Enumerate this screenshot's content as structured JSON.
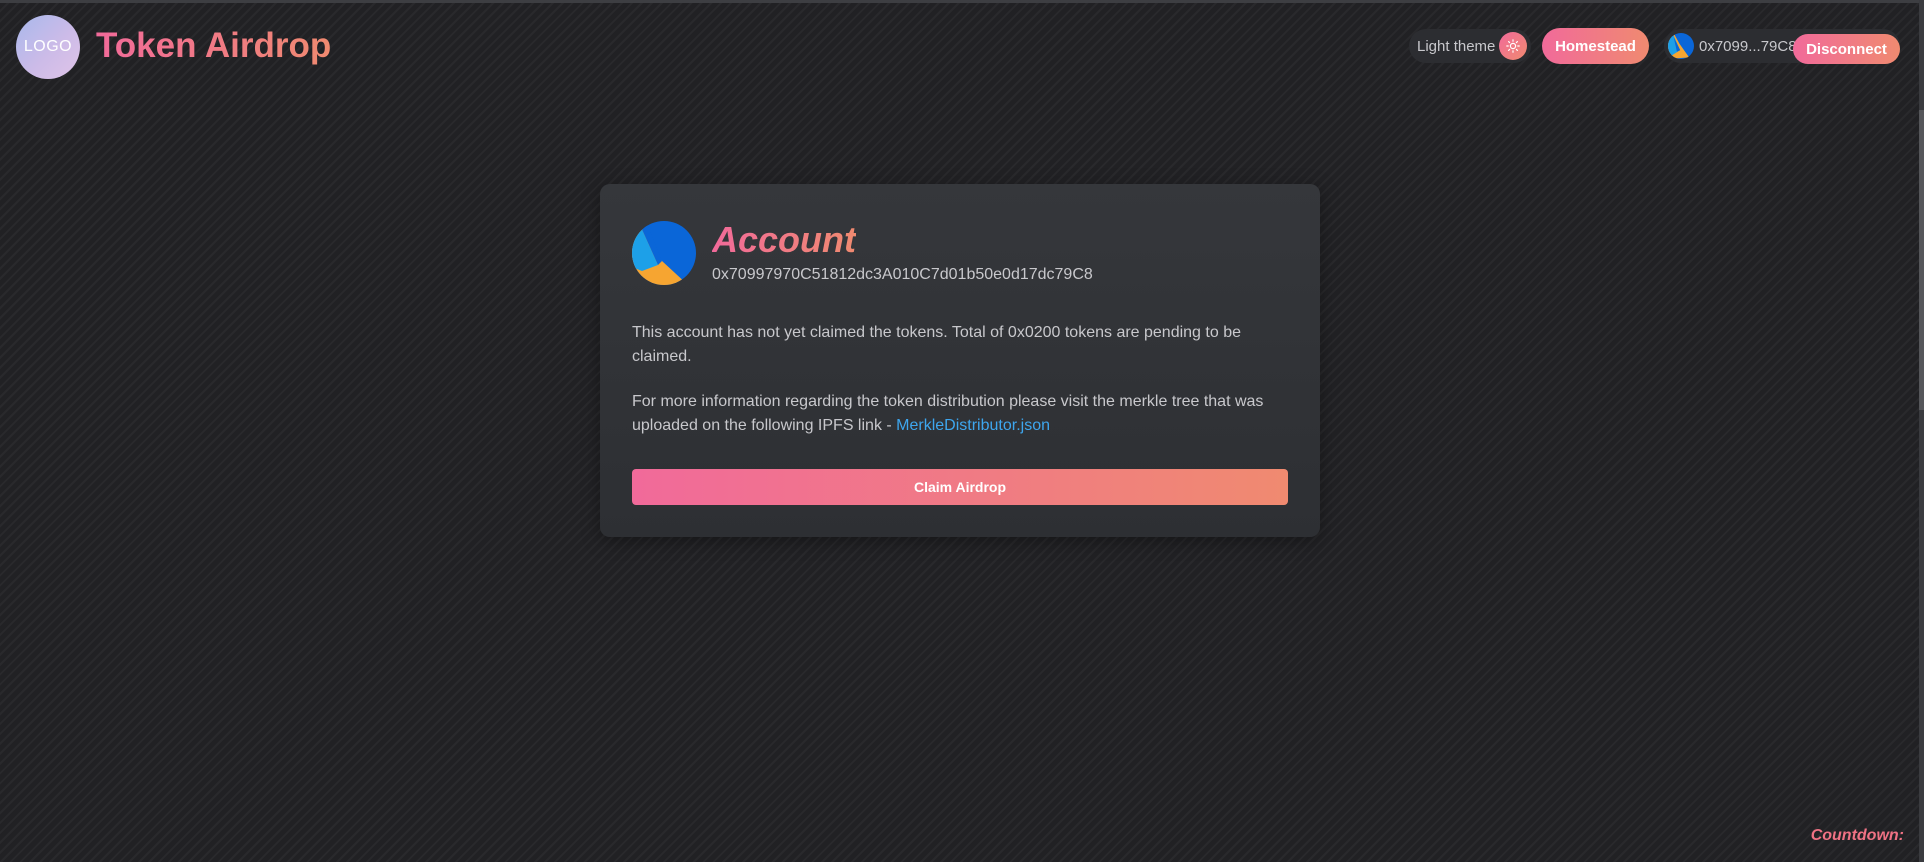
{
  "header": {
    "logo_text": "LOGO",
    "title": "Token Airdrop",
    "theme_toggle_label": "Light theme",
    "network_button_label": "Homestead",
    "account_short": "0x7099...79C8",
    "disconnect_label": "Disconnect"
  },
  "card": {
    "title": "Account",
    "address": "0x70997970C51812dc3A010C7d01b50e0d17dc79C8",
    "status_text": "This account has not yet claimed the tokens. Total of 0x0200 tokens are pending to be claimed.",
    "info_text": "For more information regarding the token distribution please visit the merkle tree that was uploaded on the following IPFS link - ",
    "info_link_text": "MerkleDistributor.json",
    "claim_button_label": "Claim Airdrop"
  },
  "footer": {
    "countdown_label": "Countdown:"
  },
  "colors": {
    "background": "#212124",
    "card": "#323438",
    "accent_start": "#f16a9a",
    "accent_end": "#f08a70",
    "link": "#3ea6ee",
    "avatar_blue": "#0a66d8",
    "avatar_orange": "#f6a531",
    "avatar_light_blue": "#1da0e8"
  },
  "icons": {
    "theme": "sun-icon",
    "avatar": "jazzicon-avatar"
  }
}
